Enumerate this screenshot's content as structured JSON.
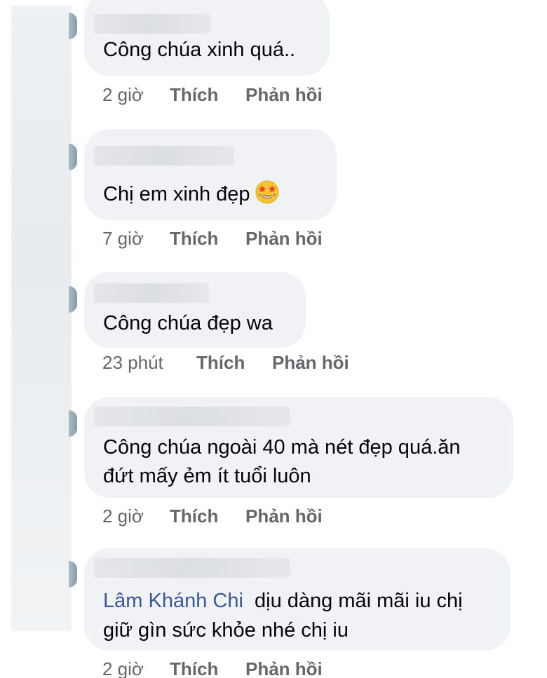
{
  "comments": [
    {
      "text": "Công chúa xinh quá..",
      "time": "2 giờ",
      "like": "Thích",
      "reply": "Phản hồi"
    },
    {
      "text": "Chị em xinh đẹp",
      "emoji": "star-struck-emoji",
      "time": "7 giờ",
      "like": "Thích",
      "reply": "Phản hồi"
    },
    {
      "text": "Công chúa đẹp wa",
      "time": "23 phút",
      "like": "Thích",
      "reply": "Phản hồi"
    },
    {
      "line1": "Công chúa ngoài 40 mà nét đẹp quá.ăn",
      "line2": "đứt mấy ẻm ít tuổi luôn",
      "time": "2 giờ",
      "like": "Thích",
      "reply": "Phản hồi"
    },
    {
      "mention": "Lâm Khánh Chi",
      "line1": "dịu dàng mãi mãi iu chị",
      "line2": "giữ gìn sức khỏe nhé chị iu",
      "time": "2 giờ",
      "like": "Thích",
      "reply": "Phản hồi"
    }
  ],
  "colors": {
    "bubble": "#f0f2f5",
    "text": "#050505",
    "meta": "#65676b",
    "mention": "#385898"
  }
}
